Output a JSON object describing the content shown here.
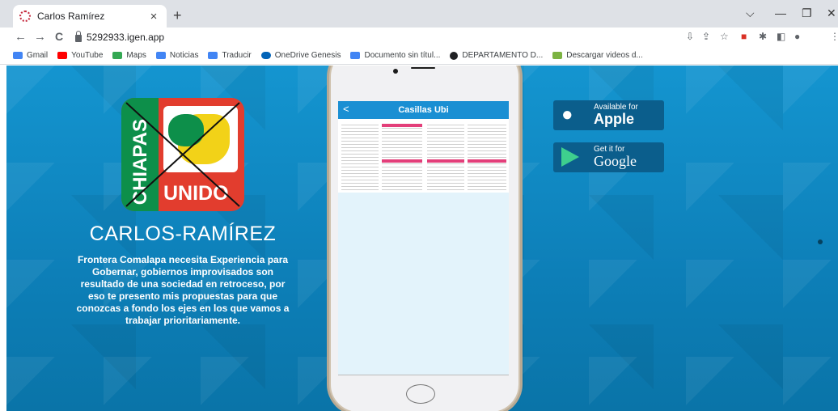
{
  "browser": {
    "tab": {
      "title": "Carlos Ramírez",
      "close": "×"
    },
    "new_tab": "+",
    "window_controls": {
      "dropdown": "⌵",
      "minimize": "—",
      "restore": "❐",
      "close": "✕"
    },
    "nav": {
      "back": "←",
      "forward": "→",
      "reload": "C"
    },
    "address": "5292933.igen.app"
  },
  "bookmarks": [
    {
      "label": "Gmail",
      "color": "#4285f4"
    },
    {
      "label": "YouTube",
      "color": "#ff0000"
    },
    {
      "label": "Maps",
      "color": "#34a853"
    },
    {
      "label": "Noticias",
      "color": "#4285f4"
    },
    {
      "label": "Traducir",
      "color": "#4285f4"
    },
    {
      "label": "OneDrive Genesis",
      "color": "#0364b8"
    },
    {
      "label": "Documento sin títul...",
      "color": "#4285f4"
    },
    {
      "label": "DEPARTAMENTO D...",
      "color": "#202124"
    },
    {
      "label": "Descargar videos d...",
      "color": "#7cb342"
    }
  ],
  "logo": {
    "left_text": "CHIAPAS",
    "bottom_text": "UNIDO"
  },
  "candidate_name": "CARLOS-RAMÍREZ",
  "intro_text": "Frontera Comalapa necesita Experiencia para Gobernar, gobiernos improvisados son resultado de una sociedad en retroceso, por eso te presento mis propuestas para que conozcas a fondo los ejes en los que vamos a trabajar prioritariamente.",
  "phone": {
    "screen_title": "Casillas Ubi",
    "back": "<"
  },
  "badges": {
    "apple": {
      "small": "Available for",
      "big": "Apple"
    },
    "google": {
      "small": "Get it for",
      "big": "Google"
    }
  }
}
